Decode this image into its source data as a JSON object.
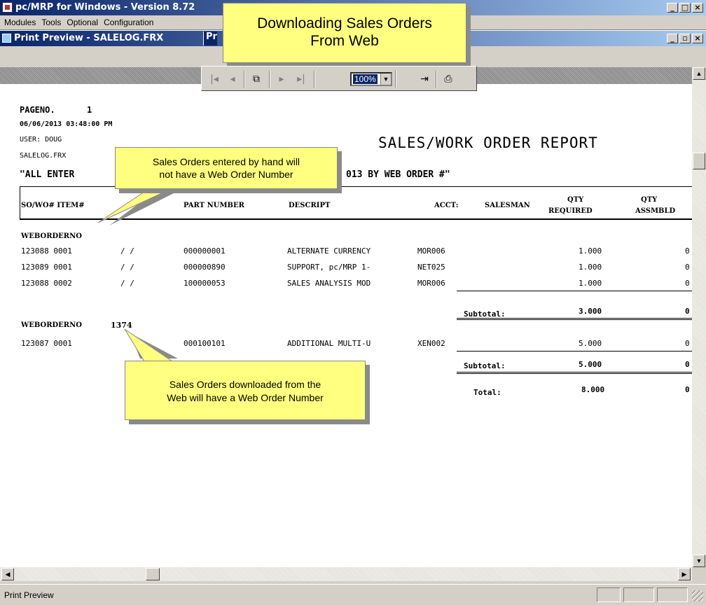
{
  "app": {
    "title": "pc/MRP for Windows - Version 8.72",
    "caption_buttons": [
      "_",
      "□",
      "×"
    ]
  },
  "menu": [
    "Modules",
    "Tools",
    "Optional",
    "Configuration"
  ],
  "child_window": {
    "title": "Print Preview - SALELOG.FRX",
    "second_tab": "Pr",
    "caption_buttons": [
      "_",
      "▫",
      "×"
    ]
  },
  "toolbar": {
    "first_icon": "first-page-icon",
    "prev_icon": "prev-page-icon",
    "pages_icon": "multi-page-icon",
    "next_icon": "next-page-icon",
    "last_icon": "last-page-icon",
    "zoom_value": "100%",
    "close_icon": "close-preview-icon",
    "print_icon": "printer-icon"
  },
  "report": {
    "pageno_label": "PAGENO.",
    "pageno_value": "1",
    "datetime": "06/06/2013 03:48:00 PM",
    "user": "USER: DOUG",
    "file": "SALELOG.FRX",
    "title": "SALES/WORK ORDER REPORT",
    "subtitle_left": "\"ALL    ENTER",
    "subtitle_right": "013 BY WEB ORDER #\"",
    "columns": {
      "so": "SO/WO# ITEM#",
      "part": "PART NUMBER",
      "descript": "DESCRIPT",
      "acct": "ACCT:",
      "salesman": "SALESMAN",
      "qty_req_1": "QTY",
      "qty_req_2": "REQUIRED",
      "qty_asm_1": "QTY",
      "qty_asm_2": "ASSMBLD"
    },
    "groups": [
      {
        "label": "WEBORDERNO",
        "value": "",
        "rows": [
          {
            "so": "123088 0001",
            "date": "/ /",
            "part": "000000001",
            "desc": "ALTERNATE CURRENCY",
            "acct": "MOR006",
            "qty": "1.000",
            "asm": "0"
          },
          {
            "so": "123089 0001",
            "date": "/ /",
            "part": "000000890",
            "desc": "SUPPORT, pc/MRP 1-",
            "acct": "NET025",
            "qty": "1.000",
            "asm": "0"
          },
          {
            "so": "123088 0002",
            "date": "/ /",
            "part": "100000053",
            "desc": "SALES ANALYSIS MOD",
            "acct": "MOR006",
            "qty": "1.000",
            "asm": "0"
          }
        ],
        "subtotal_label": "Subtotal:",
        "subtotal_qty": "3.000",
        "subtotal_asm": "0"
      },
      {
        "label": "WEBORDERNO",
        "value": "1374",
        "rows": [
          {
            "so": "123087 0001",
            "date": "",
            "part": "000100101",
            "desc": "ADDITIONAL MULTI-U",
            "acct": "XEN002",
            "qty": "5.000",
            "asm": "0"
          }
        ],
        "subtotal_label": "Subtotal:",
        "subtotal_qty": "5.000",
        "subtotal_asm": "0"
      }
    ],
    "total_label": "Total:",
    "total_qty": "8.000",
    "total_asm": "0"
  },
  "callouts": {
    "top_line1": "Downloading Sales Orders",
    "top_line2": "From Web",
    "hand_line1": "Sales Orders entered by hand will",
    "hand_line2": "not have a Web Order Number",
    "web_line1": "Sales Orders downloaded from the",
    "web_line2": "Web will have a Web Order Number"
  },
  "status": {
    "text": "Print Preview"
  },
  "colors": {
    "title_bar": "#0a246a",
    "callout_fill": "#ffff80",
    "face": "#d4d0c8"
  }
}
